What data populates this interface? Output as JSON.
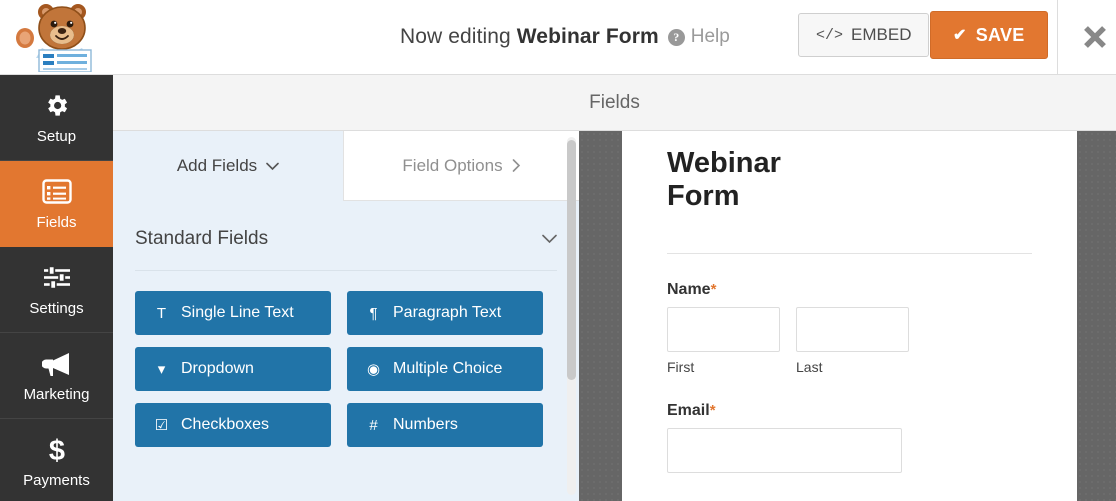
{
  "topbar": {
    "logo_alt": "wpforms-mascot-logo",
    "editing_prefix": "Now editing ",
    "form_name": "Webinar Form",
    "help_label": "Help",
    "help_icon": "question-circle-icon",
    "embed_label": "EMBED",
    "embed_icon": "code-brackets-icon",
    "save_label": "SAVE",
    "save_icon": "check-icon",
    "close_icon": "close-x-icon",
    "accent_orange": "#e27730"
  },
  "sidebar": {
    "items": [
      {
        "label": "Setup",
        "icon": "gear-icon",
        "active": false
      },
      {
        "label": "Fields",
        "icon": "form-list-icon",
        "active": true
      },
      {
        "label": "Settings",
        "icon": "sliders-icon",
        "active": false
      },
      {
        "label": "Marketing",
        "icon": "megaphone-icon",
        "active": false
      },
      {
        "label": "Payments",
        "icon": "dollar-sign-icon",
        "active": false
      }
    ]
  },
  "panel": {
    "header_title": "Fields",
    "tabs": [
      {
        "label": "Add Fields",
        "icon": "chevron-down-icon",
        "active": true
      },
      {
        "label": "Field Options",
        "icon": "chevron-right-icon",
        "active": false
      }
    ],
    "section": {
      "title": "Standard Fields",
      "collapse_icon": "chevron-down-icon"
    },
    "fields": [
      {
        "label": "Single Line Text",
        "icon": "text-cursor-icon",
        "glyph": "T"
      },
      {
        "label": "Paragraph Text",
        "icon": "paragraph-icon",
        "glyph": "¶"
      },
      {
        "label": "Dropdown",
        "icon": "dropdown-icon",
        "glyph": "▾"
      },
      {
        "label": "Multiple Choice",
        "icon": "radio-button-icon",
        "glyph": "◉"
      },
      {
        "label": "Checkboxes",
        "icon": "checkbox-icon",
        "glyph": "☑"
      },
      {
        "label": "Numbers",
        "icon": "hash-icon",
        "glyph": "#"
      }
    ],
    "field_button_color": "#2174a8"
  },
  "preview": {
    "form_title": "Webinar Form",
    "fields": [
      {
        "label": "Name",
        "required_mark": "*",
        "sub_labels": [
          "First",
          "Last"
        ],
        "value_first": "",
        "value_last": ""
      },
      {
        "label": "Email",
        "required_mark": "*",
        "value": ""
      }
    ]
  }
}
